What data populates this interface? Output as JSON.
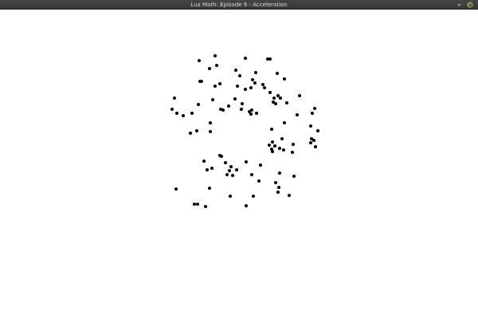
{
  "window": {
    "title": "Lua Math: Episode 9 - Acceleration",
    "title_icon": "minimize-icon",
    "close_icon": "close-icon",
    "close_color": "#86a262"
  },
  "canvas": {
    "background": "#ffffff",
    "particle_color": "#000000"
  }
}
